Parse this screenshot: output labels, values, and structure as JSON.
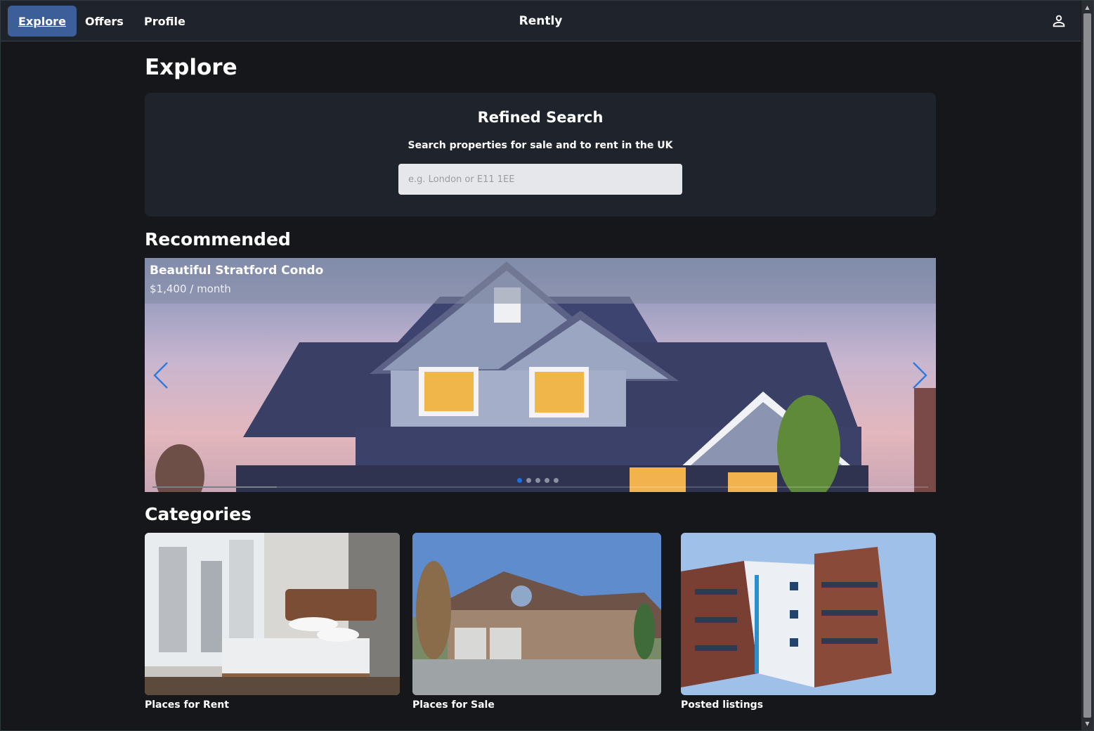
{
  "nav": {
    "items": [
      {
        "label": "Explore",
        "active": true
      },
      {
        "label": "Offers",
        "active": false
      },
      {
        "label": "Profile",
        "active": false
      }
    ],
    "brand": "Rently",
    "user_icon": "person-icon"
  },
  "page": {
    "title": "Explore"
  },
  "search": {
    "title": "Refined Search",
    "subtitle": "Search properties for sale and to rent in the UK",
    "placeholder": "e.g. London or E11 1EE",
    "value": ""
  },
  "recommended": {
    "title": "Recommended",
    "slides": [
      {
        "title": "Beautiful Stratford Condo",
        "price": "$1,400 / month"
      }
    ],
    "active_index": 0,
    "slide_count": 5,
    "progress_percent": 16
  },
  "categories": {
    "title": "Categories",
    "items": [
      {
        "label": "Places for Rent"
      },
      {
        "label": "Places for Sale"
      },
      {
        "label": "Posted listings"
      }
    ]
  },
  "colors": {
    "accent": "#3c5f99",
    "active_dot": "#1e6fdc",
    "arrow": "#2d7be0"
  }
}
